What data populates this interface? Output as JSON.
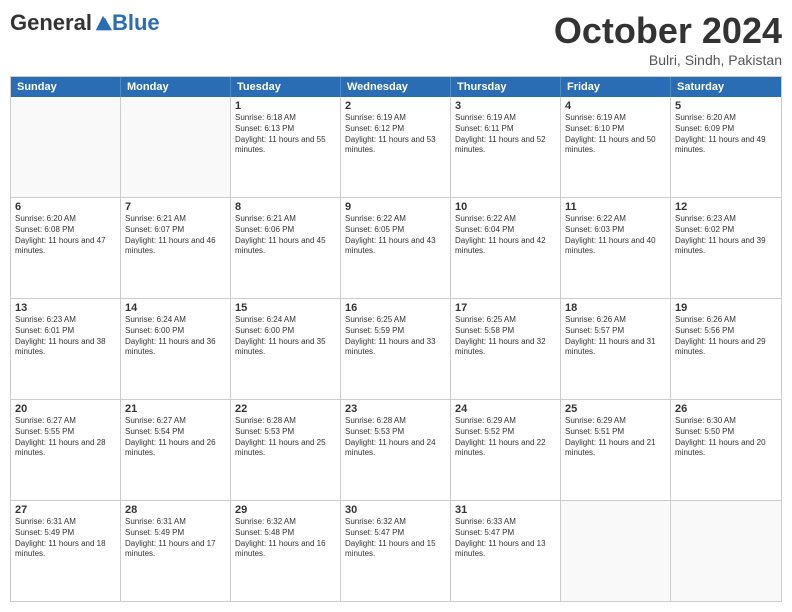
{
  "logo": {
    "general": "General",
    "blue": "Blue"
  },
  "header": {
    "month": "October 2024",
    "location": "Bulri, Sindh, Pakistan"
  },
  "days": [
    "Sunday",
    "Monday",
    "Tuesday",
    "Wednesday",
    "Thursday",
    "Friday",
    "Saturday"
  ],
  "weeks": [
    [
      {
        "empty": true
      },
      {
        "empty": true
      },
      {
        "day": "1",
        "sunrise": "Sunrise: 6:18 AM",
        "sunset": "Sunset: 6:13 PM",
        "daylight": "Daylight: 11 hours and 55 minutes."
      },
      {
        "day": "2",
        "sunrise": "Sunrise: 6:19 AM",
        "sunset": "Sunset: 6:12 PM",
        "daylight": "Daylight: 11 hours and 53 minutes."
      },
      {
        "day": "3",
        "sunrise": "Sunrise: 6:19 AM",
        "sunset": "Sunset: 6:11 PM",
        "daylight": "Daylight: 11 hours and 52 minutes."
      },
      {
        "day": "4",
        "sunrise": "Sunrise: 6:19 AM",
        "sunset": "Sunset: 6:10 PM",
        "daylight": "Daylight: 11 hours and 50 minutes."
      },
      {
        "day": "5",
        "sunrise": "Sunrise: 6:20 AM",
        "sunset": "Sunset: 6:09 PM",
        "daylight": "Daylight: 11 hours and 49 minutes."
      }
    ],
    [
      {
        "day": "6",
        "sunrise": "Sunrise: 6:20 AM",
        "sunset": "Sunset: 6:08 PM",
        "daylight": "Daylight: 11 hours and 47 minutes."
      },
      {
        "day": "7",
        "sunrise": "Sunrise: 6:21 AM",
        "sunset": "Sunset: 6:07 PM",
        "daylight": "Daylight: 11 hours and 46 minutes."
      },
      {
        "day": "8",
        "sunrise": "Sunrise: 6:21 AM",
        "sunset": "Sunset: 6:06 PM",
        "daylight": "Daylight: 11 hours and 45 minutes."
      },
      {
        "day": "9",
        "sunrise": "Sunrise: 6:22 AM",
        "sunset": "Sunset: 6:05 PM",
        "daylight": "Daylight: 11 hours and 43 minutes."
      },
      {
        "day": "10",
        "sunrise": "Sunrise: 6:22 AM",
        "sunset": "Sunset: 6:04 PM",
        "daylight": "Daylight: 11 hours and 42 minutes."
      },
      {
        "day": "11",
        "sunrise": "Sunrise: 6:22 AM",
        "sunset": "Sunset: 6:03 PM",
        "daylight": "Daylight: 11 hours and 40 minutes."
      },
      {
        "day": "12",
        "sunrise": "Sunrise: 6:23 AM",
        "sunset": "Sunset: 6:02 PM",
        "daylight": "Daylight: 11 hours and 39 minutes."
      }
    ],
    [
      {
        "day": "13",
        "sunrise": "Sunrise: 6:23 AM",
        "sunset": "Sunset: 6:01 PM",
        "daylight": "Daylight: 11 hours and 38 minutes."
      },
      {
        "day": "14",
        "sunrise": "Sunrise: 6:24 AM",
        "sunset": "Sunset: 6:00 PM",
        "daylight": "Daylight: 11 hours and 36 minutes."
      },
      {
        "day": "15",
        "sunrise": "Sunrise: 6:24 AM",
        "sunset": "Sunset: 6:00 PM",
        "daylight": "Daylight: 11 hours and 35 minutes."
      },
      {
        "day": "16",
        "sunrise": "Sunrise: 6:25 AM",
        "sunset": "Sunset: 5:59 PM",
        "daylight": "Daylight: 11 hours and 33 minutes."
      },
      {
        "day": "17",
        "sunrise": "Sunrise: 6:25 AM",
        "sunset": "Sunset: 5:58 PM",
        "daylight": "Daylight: 11 hours and 32 minutes."
      },
      {
        "day": "18",
        "sunrise": "Sunrise: 6:26 AM",
        "sunset": "Sunset: 5:57 PM",
        "daylight": "Daylight: 11 hours and 31 minutes."
      },
      {
        "day": "19",
        "sunrise": "Sunrise: 6:26 AM",
        "sunset": "Sunset: 5:56 PM",
        "daylight": "Daylight: 11 hours and 29 minutes."
      }
    ],
    [
      {
        "day": "20",
        "sunrise": "Sunrise: 6:27 AM",
        "sunset": "Sunset: 5:55 PM",
        "daylight": "Daylight: 11 hours and 28 minutes."
      },
      {
        "day": "21",
        "sunrise": "Sunrise: 6:27 AM",
        "sunset": "Sunset: 5:54 PM",
        "daylight": "Daylight: 11 hours and 26 minutes."
      },
      {
        "day": "22",
        "sunrise": "Sunrise: 6:28 AM",
        "sunset": "Sunset: 5:53 PM",
        "daylight": "Daylight: 11 hours and 25 minutes."
      },
      {
        "day": "23",
        "sunrise": "Sunrise: 6:28 AM",
        "sunset": "Sunset: 5:53 PM",
        "daylight": "Daylight: 11 hours and 24 minutes."
      },
      {
        "day": "24",
        "sunrise": "Sunrise: 6:29 AM",
        "sunset": "Sunset: 5:52 PM",
        "daylight": "Daylight: 11 hours and 22 minutes."
      },
      {
        "day": "25",
        "sunrise": "Sunrise: 6:29 AM",
        "sunset": "Sunset: 5:51 PM",
        "daylight": "Daylight: 11 hours and 21 minutes."
      },
      {
        "day": "26",
        "sunrise": "Sunrise: 6:30 AM",
        "sunset": "Sunset: 5:50 PM",
        "daylight": "Daylight: 11 hours and 20 minutes."
      }
    ],
    [
      {
        "day": "27",
        "sunrise": "Sunrise: 6:31 AM",
        "sunset": "Sunset: 5:49 PM",
        "daylight": "Daylight: 11 hours and 18 minutes."
      },
      {
        "day": "28",
        "sunrise": "Sunrise: 6:31 AM",
        "sunset": "Sunset: 5:49 PM",
        "daylight": "Daylight: 11 hours and 17 minutes."
      },
      {
        "day": "29",
        "sunrise": "Sunrise: 6:32 AM",
        "sunset": "Sunset: 5:48 PM",
        "daylight": "Daylight: 11 hours and 16 minutes."
      },
      {
        "day": "30",
        "sunrise": "Sunrise: 6:32 AM",
        "sunset": "Sunset: 5:47 PM",
        "daylight": "Daylight: 11 hours and 15 minutes."
      },
      {
        "day": "31",
        "sunrise": "Sunrise: 6:33 AM",
        "sunset": "Sunset: 5:47 PM",
        "daylight": "Daylight: 11 hours and 13 minutes."
      },
      {
        "empty": true
      },
      {
        "empty": true
      }
    ]
  ]
}
